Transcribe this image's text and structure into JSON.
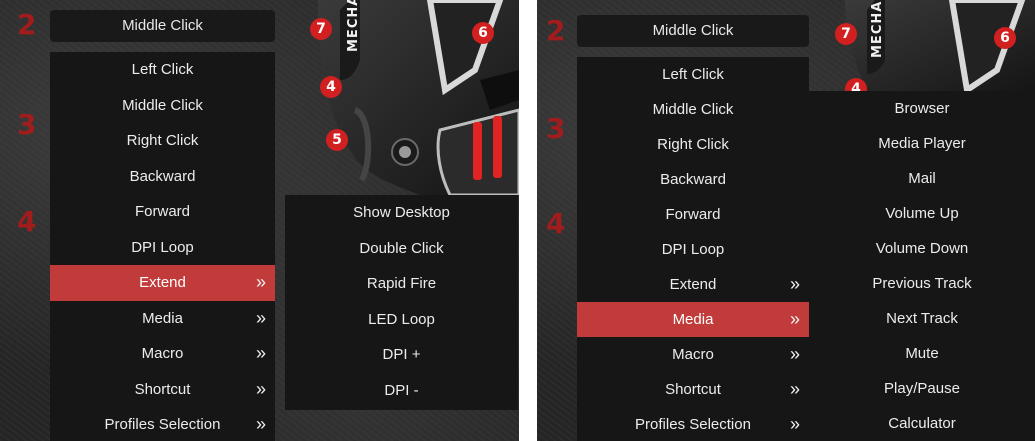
{
  "colors": {
    "menu_bg": "#161616",
    "active_bg": "#c23b3b",
    "badge": "#d21f1f",
    "step_number": "#a11d1d"
  },
  "left_panel": {
    "dropdown_value": "Middle Click",
    "step_numbers": [
      "2",
      "3",
      "4"
    ],
    "badges": [
      "7",
      "6",
      "4",
      "5"
    ],
    "brand_text": "MECHA",
    "menu_items": [
      {
        "label": "Left Click",
        "arrow": ""
      },
      {
        "label": "Middle Click",
        "arrow": ""
      },
      {
        "label": "Right Click",
        "arrow": ""
      },
      {
        "label": "Backward",
        "arrow": ""
      },
      {
        "label": "Forward",
        "arrow": ""
      },
      {
        "label": "DPI Loop",
        "arrow": ""
      },
      {
        "label": "Extend",
        "arrow": "»"
      },
      {
        "label": "Media",
        "arrow": "»"
      },
      {
        "label": "Macro",
        "arrow": "»"
      },
      {
        "label": "Shortcut",
        "arrow": "»"
      },
      {
        "label": "Profiles Selection",
        "arrow": "»"
      }
    ],
    "active_index": 6,
    "submenu_items": [
      "Show Desktop",
      "Double Click",
      "Rapid Fire",
      "LED Loop",
      "DPI +",
      "DPI -"
    ]
  },
  "right_panel": {
    "dropdown_value": "Middle Click",
    "step_numbers": [
      "2",
      "3",
      "4"
    ],
    "badges": [
      "7",
      "6",
      "4"
    ],
    "brand_text": "MECHA",
    "menu_items": [
      {
        "label": "Left Click",
        "arrow": ""
      },
      {
        "label": "Middle Click",
        "arrow": ""
      },
      {
        "label": "Right Click",
        "arrow": ""
      },
      {
        "label": "Backward",
        "arrow": ""
      },
      {
        "label": "Forward",
        "arrow": ""
      },
      {
        "label": "DPI Loop",
        "arrow": ""
      },
      {
        "label": "Extend",
        "arrow": "»"
      },
      {
        "label": "Media",
        "arrow": "»"
      },
      {
        "label": "Macro",
        "arrow": "»"
      },
      {
        "label": "Shortcut",
        "arrow": "»"
      },
      {
        "label": "Profiles Selection",
        "arrow": "»"
      }
    ],
    "active_index": 7,
    "submenu_items": [
      "Browser",
      "Media Player",
      "Mail",
      "Volume Up",
      "Volume Down",
      "Previous Track",
      "Next Track",
      "Mute",
      "Play/Pause",
      "Calculator"
    ]
  }
}
